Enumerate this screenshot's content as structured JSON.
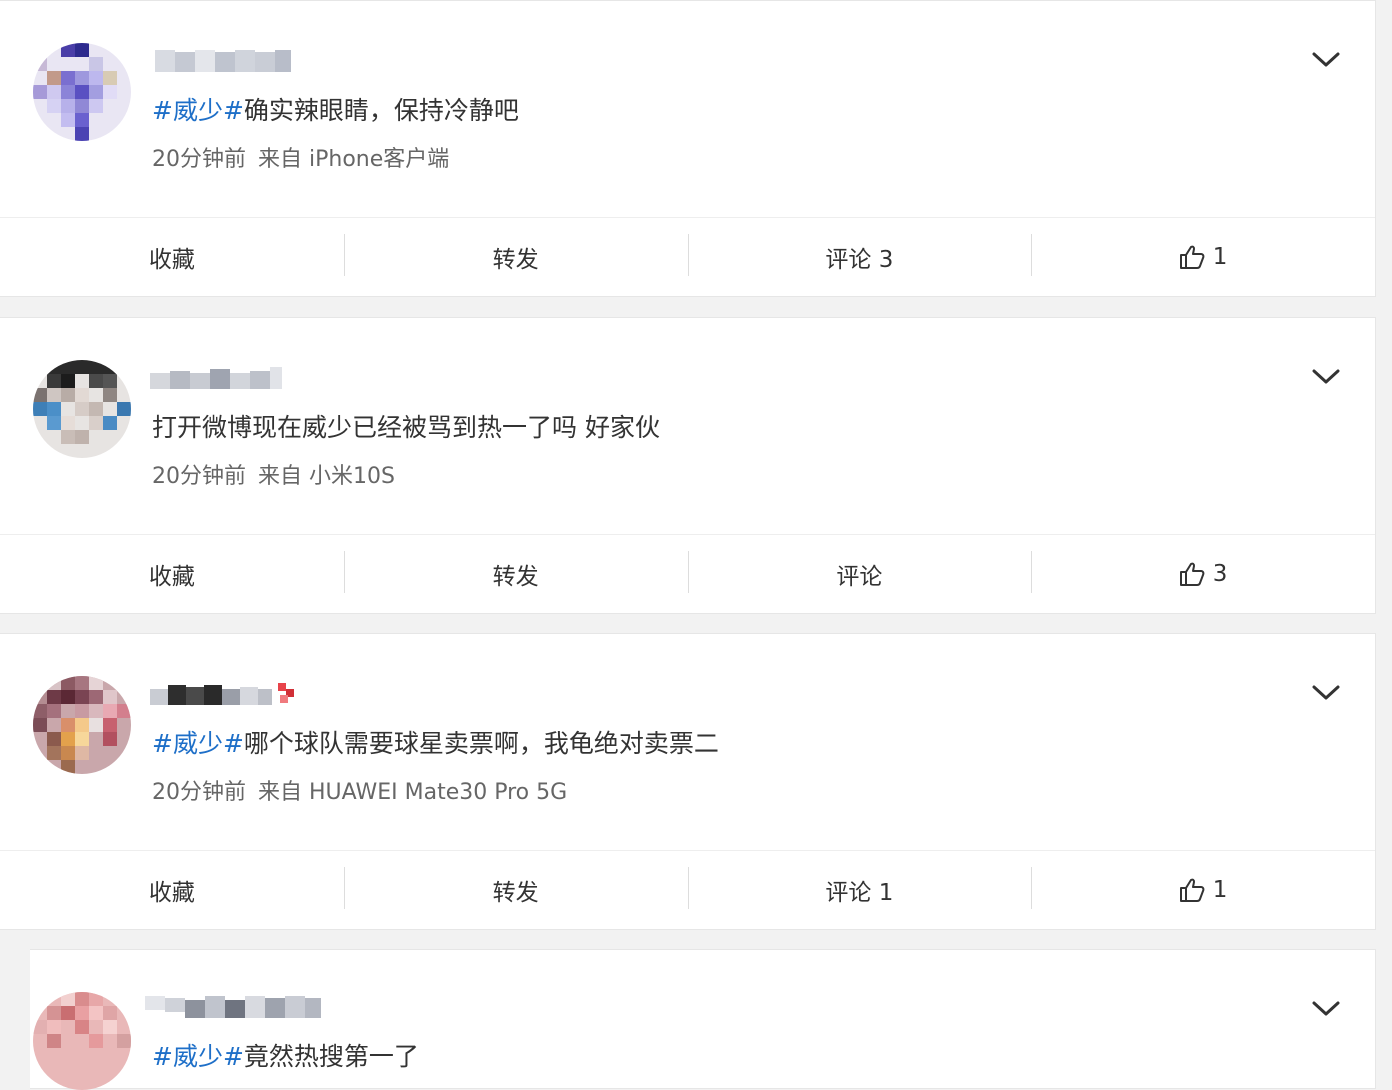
{
  "posts": [
    {
      "topic": "#威少#",
      "text": "确实辣眼睛，保持冷静吧",
      "time": "20分钟前",
      "source": "来自 iPhone客户端",
      "actions": {
        "favorite": "收藏",
        "repost": "转发",
        "comment": "评论 3",
        "like_count": "1"
      }
    },
    {
      "topic": "",
      "text": "打开微博现在威少已经被骂到热一了吗 好家伙",
      "time": "20分钟前",
      "source": "来自 小米10S",
      "actions": {
        "favorite": "收藏",
        "repost": "转发",
        "comment": "评论",
        "like_count": "3"
      }
    },
    {
      "topic": "#威少#",
      "text": "哪个球队需要球星卖票啊，我龟绝对卖票二",
      "time": "20分钟前",
      "source": "来自 HUAWEI Mate30 Pro 5G",
      "actions": {
        "favorite": "收藏",
        "repost": "转发",
        "comment": "评论 1",
        "like_count": "1"
      }
    },
    {
      "topic": "#威少#",
      "text": "竟然热搜第一了"
    }
  ],
  "icons": {
    "more": "chevron-down-icon",
    "like": "thumbs-up-icon"
  },
  "colors": {
    "topic_link": "#1e6fc8",
    "background": "#f2f2f2",
    "card": "#ffffff"
  }
}
